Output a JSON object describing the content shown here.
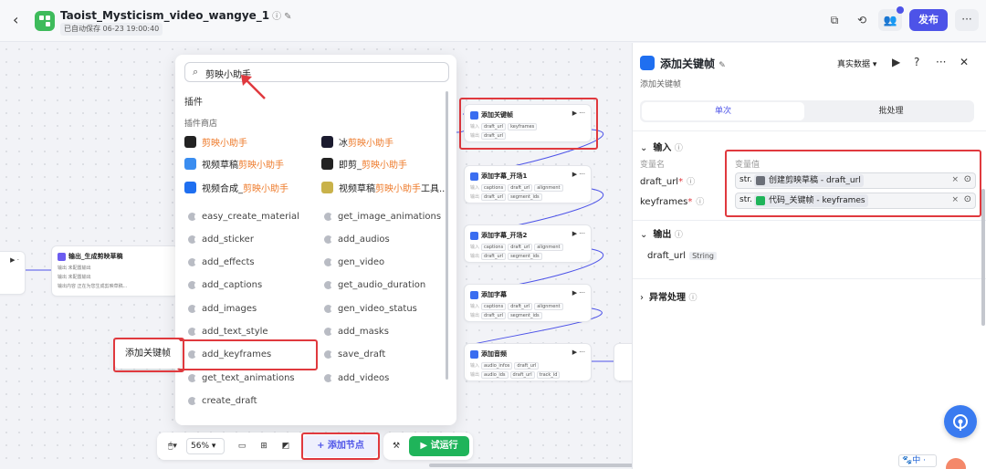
{
  "header": {
    "title": "Taoist_Mysticism_video_wangye_1",
    "saved": "已自动保存 06-23 19:00:40",
    "publish_label": "发布"
  },
  "dropdown": {
    "search_value": "剪映小助手",
    "section_title": "插件",
    "section_sub": "插件商店",
    "plugins": [
      {
        "pre": "",
        "hl": "剪映小助手",
        "post": "",
        "icon": "capcut-icon",
        "color": "#222"
      },
      {
        "pre": "冰",
        "hl": "剪映小助手",
        "post": "",
        "icon": "ice-capcut-icon",
        "color": "#1b1b2f"
      },
      {
        "pre": "视频草稿",
        "hl": "剪映小助手",
        "post": "",
        "icon": "video-draft-icon",
        "color": "#3a8df0"
      },
      {
        "pre": "即剪_",
        "hl": "剪映小助手",
        "post": "",
        "icon": "jijian-icon",
        "color": "#222"
      },
      {
        "pre": "视频合成_",
        "hl": "剪映小助手",
        "post": "",
        "icon": "video-compose-icon",
        "color": "#1f6ff0"
      },
      {
        "pre": "视频草稿",
        "hl": "剪映小助手",
        "post": "工具...",
        "icon": "video-draft-tool-icon",
        "color": "#c9b24a"
      }
    ],
    "tools_left": [
      "easy_create_material",
      "add_sticker",
      "add_effects",
      "add_captions",
      "add_images",
      "add_text_style",
      "add_keyframes",
      "get_text_animations",
      "create_draft"
    ],
    "tools_right": [
      "get_image_animations",
      "add_audios",
      "gen_video",
      "get_audio_duration",
      "gen_video_status",
      "add_masks",
      "save_draft",
      "add_videos"
    ],
    "tooltip": "添加关键帧"
  },
  "canvas": {
    "left_node": {
      "title": "输出_生成剪映草稿",
      "rows": [
        "输出 未配置输出",
        "输出 未配置输出",
        "输出内容 正在为您生成剪映草稿..."
      ]
    },
    "nodes": [
      {
        "title": "添加关键帧",
        "inputs": [
          "draft_url",
          "keyframes"
        ],
        "outputs": [
          "draft_url"
        ]
      },
      {
        "title": "添加字幕_开场1",
        "inputs": [
          "captions",
          "draft_url",
          "alignment"
        ],
        "outputs": [
          "draft_url",
          "segment_ids"
        ]
      },
      {
        "title": "添加字幕_开场2",
        "inputs": [
          "captions",
          "draft_url",
          "alignment"
        ],
        "outputs": [
          "draft_url",
          "segment_ids"
        ]
      },
      {
        "title": "添加字幕",
        "inputs": [
          "captions",
          "draft_url",
          "alignment"
        ],
        "outputs": [
          "draft_url",
          "segment_ids"
        ]
      },
      {
        "title": "添加音频",
        "inputs": [
          "audio_infos",
          "draft_url"
        ],
        "outputs": [
          "audio_ids",
          "draft_url",
          "track_id"
        ]
      }
    ]
  },
  "toolbar": {
    "zoom": "56%",
    "add_node": "+ 添加节点",
    "run": "试运行"
  },
  "panel": {
    "title": "添加关键帧",
    "subtitle": "添加关键帧",
    "data_mode": "真实数据",
    "tab_single": "单次",
    "tab_batch": "批处理",
    "input_section": "输入",
    "col_name": "变量名",
    "col_value": "变量值",
    "inputs": [
      {
        "name": "draft_url",
        "type": "str.",
        "source": "创建剪映草稿 - draft_url",
        "color": "#6b6f78"
      },
      {
        "name": "keyframes",
        "type": "str.",
        "source": "代码_关键帧 - keyframes",
        "color": "#1fb45a"
      }
    ],
    "output_section": "输出",
    "outputs": [
      {
        "name": "draft_url",
        "type": "String"
      }
    ],
    "error_section": "异常处理",
    "ime": "中"
  }
}
